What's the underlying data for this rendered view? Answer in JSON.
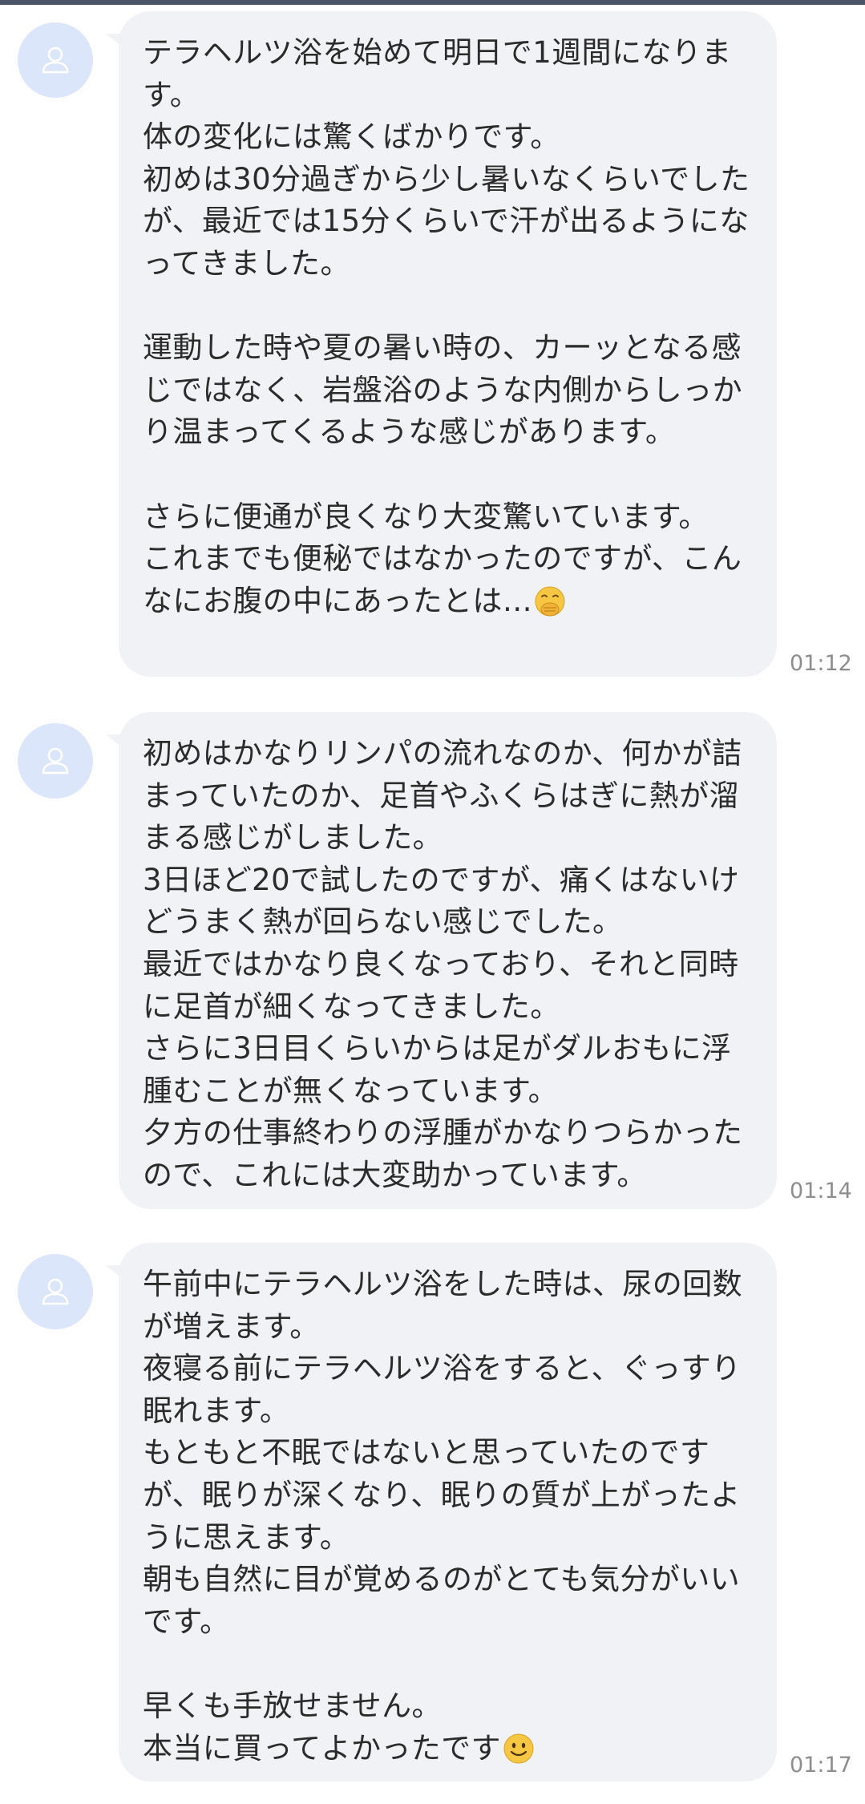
{
  "messages": [
    {
      "text": "テラヘルツ浴を始めて明日で1週間になります。\n体の変化には驚くばかりです。\n初めは30分過ぎから少し暑いなくらいでしたが、最近では15分くらいで汗が出るようになってきました。\n\n運動した時や夏の暑い時の、カーッとなる感じではなく、岩盤浴のような内側からしっかり温まってくるような感じがあります。\n\nさらに便通が良くなり大変驚いています。\nこれまでも便秘ではなかったのですが、こんなにお腹の中にあったとは…",
      "emoji": "face-with-hand-over-mouth-icon",
      "time": "01:12"
    },
    {
      "text": "初めはかなりリンパの流れなのか、何かが詰まっていたのか、足首やふくらはぎに熱が溜まる感じがしました。\n3日ほど20で試したのですが、痛くはないけどうまく熱が回らない感じでした。\n最近ではかなり良くなっており、それと同時に足首が細くなってきました。\nさらに3日目くらいからは足がダルおもに浮腫むことが無くなっています。\n夕方の仕事終わりの浮腫がかなりつらかったので、これには大変助かっています。",
      "emoji": "",
      "time": "01:14"
    },
    {
      "text": "午前中にテラヘルツ浴をした時は、尿の回数が増えます。\n夜寝る前にテラヘルツ浴をすると、ぐっすり眠れます。\nもともと不眠ではないと思っていたのですが、眠りが深くなり、眠りの質が上がったように思えます。\n朝も自然に目が覚めるのがとても気分がいいです。\n\n早くも手放せません。\n本当に買ってよかったです",
      "emoji": "slightly-smiling-face-icon",
      "time": "01:17"
    }
  ],
  "colors": {
    "bubble": "#f1f2f5",
    "avatar_bg": "#dce6fb",
    "avatar_icon": "#ffffff",
    "text": "#2b2b2b",
    "timestamp": "#8d8d8d",
    "top_line": "#4b5566"
  },
  "icons": {
    "avatar": "user-icon"
  }
}
